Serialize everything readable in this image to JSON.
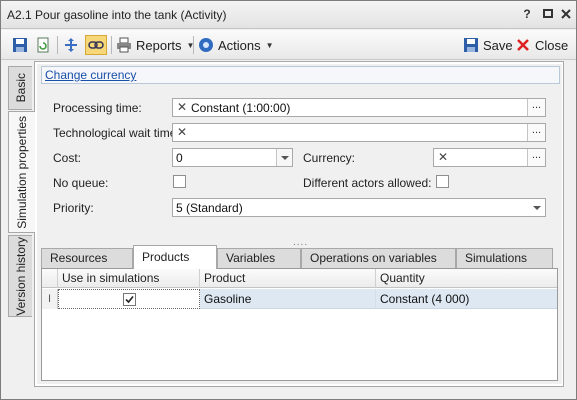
{
  "window": {
    "title": "A2.1 Pour gasoline into the tank (Activity)",
    "help_label": "?",
    "restore_icon": "restore-icon",
    "close_icon": "close-icon"
  },
  "toolbar": {
    "reports_label": "Reports",
    "actions_label": "Actions",
    "save_label": "Save",
    "close_label": "Close"
  },
  "side_tabs": [
    {
      "label": "Basic"
    },
    {
      "label": "Simulation properties"
    },
    {
      "label": "Version history"
    }
  ],
  "form": {
    "change_currency_link": "Change currency",
    "processing_time_label": "Processing time:",
    "processing_time_value": "Constant (1:00:00)",
    "tech_wait_label": "Technological wait time:",
    "tech_wait_value": "",
    "cost_label": "Cost:",
    "cost_value": "0",
    "currency_label": "Currency:",
    "currency_value": "",
    "no_queue_label": "No queue:",
    "no_queue_checked": false,
    "diff_actors_label": "Different actors allowed:",
    "diff_actors_checked": false,
    "priority_label": "Priority:",
    "priority_value": "5 (Standard)",
    "clear_glyph": "✕",
    "ellipsis_glyph": "..."
  },
  "bottom_tabs": [
    {
      "label": "Resources"
    },
    {
      "label": "Products"
    },
    {
      "label": "Variables"
    },
    {
      "label": "Operations on variables"
    },
    {
      "label": "Simulations"
    }
  ],
  "grid": {
    "columns": [
      "Use in simulations",
      "Product",
      "Quantity"
    ],
    "rows": [
      {
        "use_in_simulations": true,
        "product": "Gasoline",
        "quantity": "Constant (4 000)"
      }
    ]
  }
}
